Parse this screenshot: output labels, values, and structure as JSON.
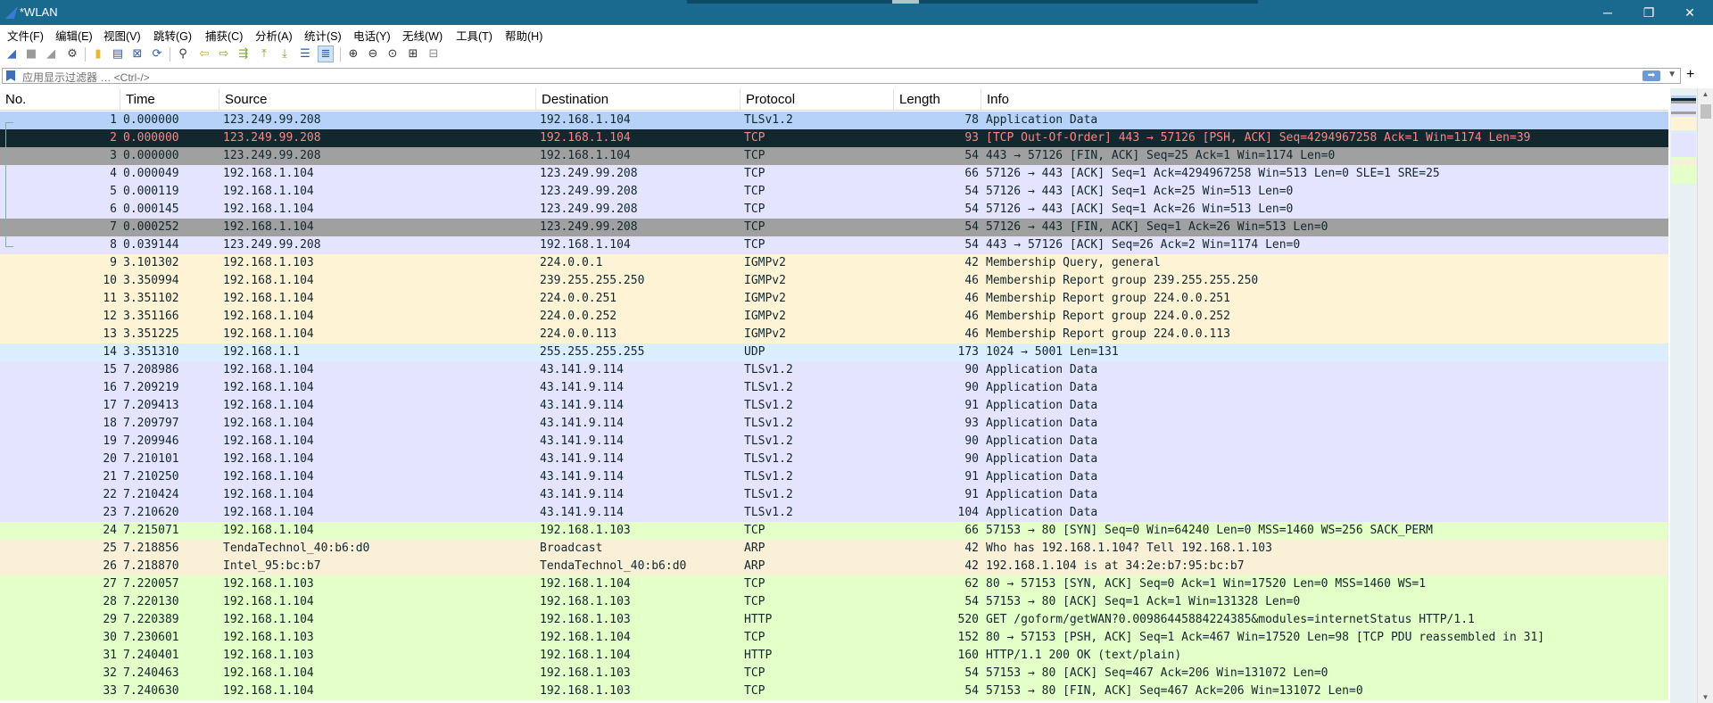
{
  "window": {
    "title": "*WLAN",
    "minimize": "─",
    "restore": "❐",
    "close": "✕"
  },
  "menu": [
    "文件(F)",
    "编辑(E)",
    "视图(V)",
    "跳转(G)",
    "捕获(C)",
    "分析(A)",
    "统计(S)",
    "电话(Y)",
    "无线(W)",
    "工具(T)",
    "帮助(H)"
  ],
  "filter": {
    "placeholder": "应用显示过滤器 … <Ctrl-/>",
    "add": "+"
  },
  "columns": {
    "no": "No.",
    "time": "Time",
    "source": "Source",
    "destination": "Destination",
    "protocol": "Protocol",
    "length": "Length",
    "info": "Info"
  },
  "colors": {
    "tls": "#e4e4ff",
    "tls_selected": "#b6d2f8",
    "tcp_error": "#12272e",
    "tcp_error_text": "#f78787",
    "tcp_fin": "#a0a0a0",
    "igmp": "#fff3d6",
    "udp": "#daeeff",
    "http": "#e4ffc7",
    "arp": "#faf0d7"
  },
  "packets": [
    {
      "no": "1",
      "time": "0.000000",
      "src": "123.249.99.208",
      "dst": "192.168.1.104",
      "proto": "TLSv1.2",
      "len": "78",
      "info": "Application Data",
      "bg": "#b6d2f8",
      "fg": "#12272e"
    },
    {
      "no": "2",
      "time": "0.000000",
      "src": "123.249.99.208",
      "dst": "192.168.1.104",
      "proto": "TCP",
      "len": "93",
      "info": "[TCP Out-Of-Order] 443 → 57126 [PSH, ACK] Seq=4294967258 Ack=1 Win=1174 Len=39",
      "bg": "#12272e",
      "fg": "#f78787"
    },
    {
      "no": "3",
      "time": "0.000000",
      "src": "123.249.99.208",
      "dst": "192.168.1.104",
      "proto": "TCP",
      "len": "54",
      "info": "443 → 57126 [FIN, ACK] Seq=25 Ack=1 Win=1174 Len=0",
      "bg": "#a0a0a0",
      "fg": "#12272e"
    },
    {
      "no": "4",
      "time": "0.000049",
      "src": "192.168.1.104",
      "dst": "123.249.99.208",
      "proto": "TCP",
      "len": "66",
      "info": "57126 → 443 [ACK] Seq=1 Ack=4294967258 Win=513 Len=0 SLE=1 SRE=25",
      "bg": "#e4e4ff",
      "fg": "#12272e"
    },
    {
      "no": "5",
      "time": "0.000119",
      "src": "192.168.1.104",
      "dst": "123.249.99.208",
      "proto": "TCP",
      "len": "54",
      "info": "57126 → 443 [ACK] Seq=1 Ack=25 Win=513 Len=0",
      "bg": "#e4e4ff",
      "fg": "#12272e"
    },
    {
      "no": "6",
      "time": "0.000145",
      "src": "192.168.1.104",
      "dst": "123.249.99.208",
      "proto": "TCP",
      "len": "54",
      "info": "57126 → 443 [ACK] Seq=1 Ack=26 Win=513 Len=0",
      "bg": "#e4e4ff",
      "fg": "#12272e"
    },
    {
      "no": "7",
      "time": "0.000252",
      "src": "192.168.1.104",
      "dst": "123.249.99.208",
      "proto": "TCP",
      "len": "54",
      "info": "57126 → 443 [FIN, ACK] Seq=1 Ack=26 Win=513 Len=0",
      "bg": "#a0a0a0",
      "fg": "#12272e"
    },
    {
      "no": "8",
      "time": "0.039144",
      "src": "123.249.99.208",
      "dst": "192.168.1.104",
      "proto": "TCP",
      "len": "54",
      "info": "443 → 57126 [ACK] Seq=26 Ack=2 Win=1174 Len=0",
      "bg": "#e4e4ff",
      "fg": "#12272e"
    },
    {
      "no": "9",
      "time": "3.101302",
      "src": "192.168.1.103",
      "dst": "224.0.0.1",
      "proto": "IGMPv2",
      "len": "42",
      "info": "Membership Query, general",
      "bg": "#fff3d6",
      "fg": "#12272e"
    },
    {
      "no": "10",
      "time": "3.350994",
      "src": "192.168.1.104",
      "dst": "239.255.255.250",
      "proto": "IGMPv2",
      "len": "46",
      "info": "Membership Report group 239.255.255.250",
      "bg": "#fff3d6",
      "fg": "#12272e"
    },
    {
      "no": "11",
      "time": "3.351102",
      "src": "192.168.1.104",
      "dst": "224.0.0.251",
      "proto": "IGMPv2",
      "len": "46",
      "info": "Membership Report group 224.0.0.251",
      "bg": "#fff3d6",
      "fg": "#12272e"
    },
    {
      "no": "12",
      "time": "3.351166",
      "src": "192.168.1.104",
      "dst": "224.0.0.252",
      "proto": "IGMPv2",
      "len": "46",
      "info": "Membership Report group 224.0.0.252",
      "bg": "#fff3d6",
      "fg": "#12272e"
    },
    {
      "no": "13",
      "time": "3.351225",
      "src": "192.168.1.104",
      "dst": "224.0.0.113",
      "proto": "IGMPv2",
      "len": "46",
      "info": "Membership Report group 224.0.0.113",
      "bg": "#fff3d6",
      "fg": "#12272e"
    },
    {
      "no": "14",
      "time": "3.351310",
      "src": "192.168.1.1",
      "dst": "255.255.255.255",
      "proto": "UDP",
      "len": "173",
      "info": "1024 → 5001 Len=131",
      "bg": "#daeeff",
      "fg": "#12272e"
    },
    {
      "no": "15",
      "time": "7.208986",
      "src": "192.168.1.104",
      "dst": "43.141.9.114",
      "proto": "TLSv1.2",
      "len": "90",
      "info": "Application Data",
      "bg": "#e4e4ff",
      "fg": "#12272e"
    },
    {
      "no": "16",
      "time": "7.209219",
      "src": "192.168.1.104",
      "dst": "43.141.9.114",
      "proto": "TLSv1.2",
      "len": "90",
      "info": "Application Data",
      "bg": "#e4e4ff",
      "fg": "#12272e"
    },
    {
      "no": "17",
      "time": "7.209413",
      "src": "192.168.1.104",
      "dst": "43.141.9.114",
      "proto": "TLSv1.2",
      "len": "91",
      "info": "Application Data",
      "bg": "#e4e4ff",
      "fg": "#12272e"
    },
    {
      "no": "18",
      "time": "7.209797",
      "src": "192.168.1.104",
      "dst": "43.141.9.114",
      "proto": "TLSv1.2",
      "len": "93",
      "info": "Application Data",
      "bg": "#e4e4ff",
      "fg": "#12272e"
    },
    {
      "no": "19",
      "time": "7.209946",
      "src": "192.168.1.104",
      "dst": "43.141.9.114",
      "proto": "TLSv1.2",
      "len": "90",
      "info": "Application Data",
      "bg": "#e4e4ff",
      "fg": "#12272e"
    },
    {
      "no": "20",
      "time": "7.210101",
      "src": "192.168.1.104",
      "dst": "43.141.9.114",
      "proto": "TLSv1.2",
      "len": "90",
      "info": "Application Data",
      "bg": "#e4e4ff",
      "fg": "#12272e"
    },
    {
      "no": "21",
      "time": "7.210250",
      "src": "192.168.1.104",
      "dst": "43.141.9.114",
      "proto": "TLSv1.2",
      "len": "91",
      "info": "Application Data",
      "bg": "#e4e4ff",
      "fg": "#12272e"
    },
    {
      "no": "22",
      "time": "7.210424",
      "src": "192.168.1.104",
      "dst": "43.141.9.114",
      "proto": "TLSv1.2",
      "len": "91",
      "info": "Application Data",
      "bg": "#e4e4ff",
      "fg": "#12272e"
    },
    {
      "no": "23",
      "time": "7.210620",
      "src": "192.168.1.104",
      "dst": "43.141.9.114",
      "proto": "TLSv1.2",
      "len": "104",
      "info": "Application Data",
      "bg": "#e4e4ff",
      "fg": "#12272e"
    },
    {
      "no": "24",
      "time": "7.215071",
      "src": "192.168.1.104",
      "dst": "192.168.1.103",
      "proto": "TCP",
      "len": "66",
      "info": "57153 → 80 [SYN] Seq=0 Win=64240 Len=0 MSS=1460 WS=256 SACK_PERM",
      "bg": "#e4ffc7",
      "fg": "#12272e"
    },
    {
      "no": "25",
      "time": "7.218856",
      "src": "TendaTechnol_40:b6:d0",
      "dst": "Broadcast",
      "proto": "ARP",
      "len": "42",
      "info": "Who has 192.168.1.104? Tell 192.168.1.103",
      "bg": "#faf0d7",
      "fg": "#12272e"
    },
    {
      "no": "26",
      "time": "7.218870",
      "src": "Intel_95:bc:b7",
      "dst": "TendaTechnol_40:b6:d0",
      "proto": "ARP",
      "len": "42",
      "info": "192.168.1.104 is at 34:2e:b7:95:bc:b7",
      "bg": "#faf0d7",
      "fg": "#12272e"
    },
    {
      "no": "27",
      "time": "7.220057",
      "src": "192.168.1.103",
      "dst": "192.168.1.104",
      "proto": "TCP",
      "len": "62",
      "info": "80 → 57153 [SYN, ACK] Seq=0 Ack=1 Win=17520 Len=0 MSS=1460 WS=1",
      "bg": "#e4ffc7",
      "fg": "#12272e"
    },
    {
      "no": "28",
      "time": "7.220130",
      "src": "192.168.1.104",
      "dst": "192.168.1.103",
      "proto": "TCP",
      "len": "54",
      "info": "57153 → 80 [ACK] Seq=1 Ack=1 Win=131328 Len=0",
      "bg": "#e4ffc7",
      "fg": "#12272e"
    },
    {
      "no": "29",
      "time": "7.220389",
      "src": "192.168.1.104",
      "dst": "192.168.1.103",
      "proto": "HTTP",
      "len": "520",
      "info": "GET /goform/getWAN?0.00986445884224385&modules=internetStatus HTTP/1.1",
      "bg": "#e4ffc7",
      "fg": "#12272e"
    },
    {
      "no": "30",
      "time": "7.230601",
      "src": "192.168.1.103",
      "dst": "192.168.1.104",
      "proto": "TCP",
      "len": "152",
      "info": "80 → 57153 [PSH, ACK] Seq=1 Ack=467 Win=17520 Len=98 [TCP PDU reassembled in 31]",
      "bg": "#e4ffc7",
      "fg": "#12272e"
    },
    {
      "no": "31",
      "time": "7.240401",
      "src": "192.168.1.103",
      "dst": "192.168.1.104",
      "proto": "HTTP",
      "len": "160",
      "info": "HTTP/1.1 200 OK  (text/plain)",
      "bg": "#e4ffc7",
      "fg": "#12272e"
    },
    {
      "no": "32",
      "time": "7.240463",
      "src": "192.168.1.104",
      "dst": "192.168.1.103",
      "proto": "TCP",
      "len": "54",
      "info": "57153 → 80 [ACK] Seq=467 Ack=206 Win=131072 Len=0",
      "bg": "#e4ffc7",
      "fg": "#12272e"
    },
    {
      "no": "33",
      "time": "7.240630",
      "src": "192.168.1.104",
      "dst": "192.168.1.103",
      "proto": "TCP",
      "len": "54",
      "info": "57153 → 80 [FIN, ACK] Seq=467 Ack=206 Win=131072 Len=0",
      "bg": "#e4ffc7",
      "fg": "#12272e"
    }
  ]
}
